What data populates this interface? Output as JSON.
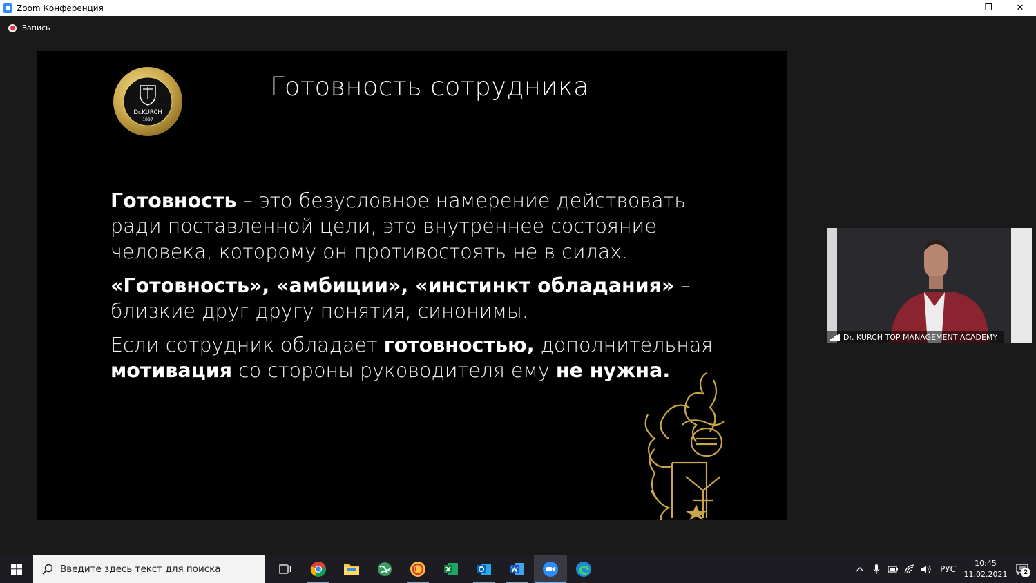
{
  "window": {
    "title": "Zoom Конференция",
    "minimize": "—",
    "restore": "❐",
    "close": "✕"
  },
  "recording": {
    "label": "Запись"
  },
  "slide": {
    "title": "Готовность сотрудника",
    "logo": {
      "name": "Dr.KURCH",
      "year": "1997",
      "ring_top": "imperare sibi maximum imperium est",
      "ring_bottom": "TOP MANAGEMENT ACADEMY"
    },
    "p1": {
      "b1": "Готовность",
      "t1": " – это безусловное намерение действовать ради поставленной цели, это внутреннее состояние человека, которому он противостоять не в силах."
    },
    "p2": {
      "b1": "«Готовность», «амбиции», «инстинкт обладания»",
      "t1": " –близкие друг другу понятия, синонимы."
    },
    "p3": {
      "t1": "Если сотрудник обладает ",
      "b1": "готовностью,",
      "t2": " дополнительная ",
      "b2": "мотивация",
      "t3": " со стороны руководителя ему ",
      "b3": "не нужна."
    }
  },
  "video": {
    "participant_name": "Dr. KURCH TOP MANAGEMENT ACADEMY"
  },
  "taskbar": {
    "search_placeholder": "Введите здесь текст для поиска",
    "apps": [
      "task-view-icon",
      "chrome-icon",
      "file-explorer-icon",
      "globe-app-icon",
      "1c-icon",
      "excel-icon",
      "outlook-icon",
      "word-icon",
      "zoom-icon",
      "edge-icon"
    ],
    "lang": "РУС",
    "time": "10:45",
    "date": "11.02.2021",
    "notifications": "2"
  },
  "colors": {
    "zoom_blue": "#2d8cff",
    "gold": "#c9a64a",
    "rec_red": "#e8333a"
  }
}
